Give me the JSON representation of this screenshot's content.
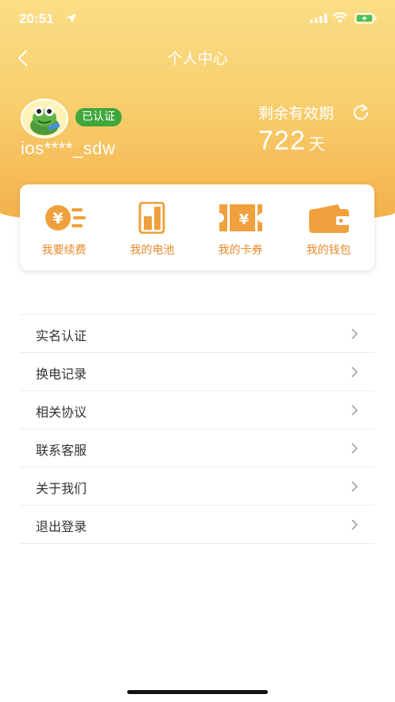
{
  "status_bar": {
    "time": "20:51"
  },
  "nav": {
    "title": "个人中心"
  },
  "profile": {
    "username": "ios****_sdw",
    "verified_badge": "已认证",
    "valid_label": "剩余有效期",
    "valid_days": "722",
    "valid_unit": "天"
  },
  "quick_actions": [
    {
      "label": "我要续费",
      "icon": "renew-yen-icon"
    },
    {
      "label": "我的电池",
      "icon": "battery-icon"
    },
    {
      "label": "我的卡券",
      "icon": "coupon-icon"
    },
    {
      "label": "我的钱包",
      "icon": "wallet-icon"
    }
  ],
  "menu": [
    {
      "label": "实名认证"
    },
    {
      "label": "换电记录"
    },
    {
      "label": "相关协议"
    },
    {
      "label": "联系客服"
    },
    {
      "label": "关于我们"
    },
    {
      "label": "退出登录"
    }
  ],
  "colors": {
    "accent": "#e88a2a",
    "badge": "#3fa73b",
    "header_top": "#fbde86",
    "header_bottom": "#f3b04a"
  }
}
